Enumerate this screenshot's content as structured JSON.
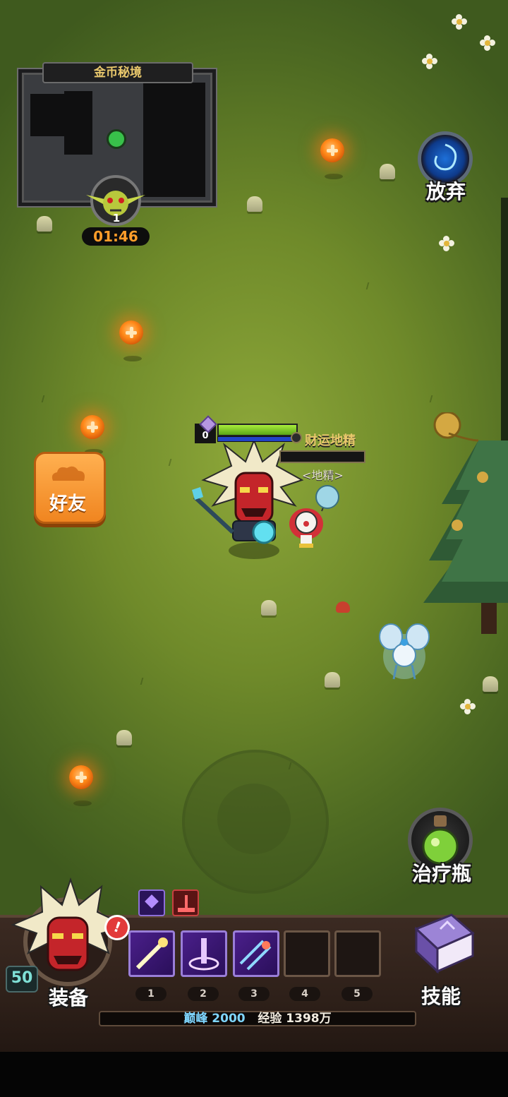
{
  "minimap": {
    "title": "金币秘境"
  },
  "boss": {
    "level": "1",
    "timer": "01:46"
  },
  "buttons": {
    "abandon": "放弃",
    "friends": "好友",
    "potion": "治疗瓶",
    "skills": "技能",
    "equipment": "装备"
  },
  "player": {
    "level": "50",
    "hp_pct": 100,
    "shield_value": "0"
  },
  "enemy": {
    "name": "财运地精",
    "subtitle": "<地精>",
    "hp_pct": 0
  },
  "skill_slots": [
    "1",
    "2",
    "3",
    "4",
    "5"
  ],
  "xp_bar": {
    "peak_label": "巅峰",
    "peak_value": "2000",
    "exp_label": "经验",
    "exp_value": "1398万"
  },
  "colors": {
    "accent_orange": "#f08520",
    "gold_text": "#e9c86c",
    "hp_green": "#7ad21e",
    "xp_cyan": "#7fd6ff"
  }
}
